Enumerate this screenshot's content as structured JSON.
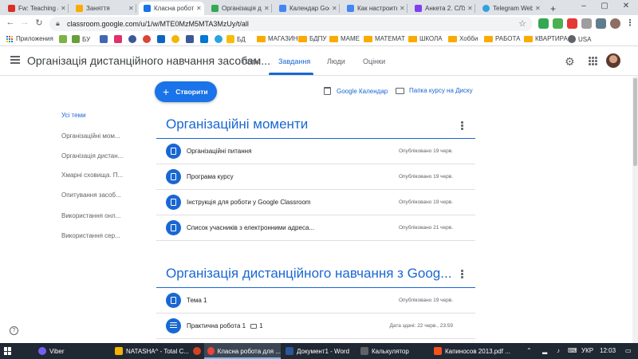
{
  "browser": {
    "tabs": [
      {
        "label": "Fw: Teaching a",
        "color": "#d93025"
      },
      {
        "label": "Заняття",
        "color": "#f9ab00"
      },
      {
        "label": "Класна робота",
        "color": "#1a73e8"
      },
      {
        "label": "Організація д",
        "color": "#34a853"
      },
      {
        "label": "Календар Goo",
        "color": "#4285f4"
      },
      {
        "label": "Как настроить",
        "color": "#4285f4"
      },
      {
        "label": "Анкета 2. СЛУ",
        "color": "#7e3ff2"
      },
      {
        "label": "Telegram Web",
        "color": "#2aa3e0"
      }
    ],
    "new_tab": "+",
    "window_controls": [
      "–",
      "▢",
      "✕"
    ],
    "url": "classroom.google.com/u/1/w/MTE0MzM5MTA3MzUy/t/all",
    "bookmarks": [
      {
        "label": "Приложения",
        "icon": "apps-icon"
      },
      {
        "label": "",
        "icon": "site-icon"
      },
      {
        "label": "БУ",
        "icon": "site-icon"
      },
      {
        "label": "БД",
        "icon": "site-icon"
      },
      {
        "label": "МАГАЗИН",
        "icon": "folder-icon"
      },
      {
        "label": "БДПУ",
        "icon": "folder-icon"
      },
      {
        "label": "МАМЕ",
        "icon": "folder-icon"
      },
      {
        "label": "МАТЕМАТ",
        "icon": "folder-icon"
      },
      {
        "label": "ШКОЛА",
        "icon": "folder-icon"
      },
      {
        "label": "Хобби",
        "icon": "folder-icon"
      },
      {
        "label": "РАБОТА",
        "icon": "folder-icon"
      },
      {
        "label": "КВАРТИРА",
        "icon": "folder-icon"
      },
      {
        "label": "USA",
        "icon": "globe-icon"
      }
    ]
  },
  "app": {
    "title": "Організація дистанційного навчання засобам...",
    "tabs": [
      "Потік",
      "Завдання",
      "Люди",
      "Оцінки"
    ],
    "active_tab": "Завдання"
  },
  "sidebar": {
    "topics": [
      "Усі теми",
      "Організаційні мом...",
      "Організація дистан...",
      "Хмарні сховища. П...",
      "Опитування засоб...",
      "Використання онл...",
      "Використання сер..."
    ]
  },
  "main": {
    "create_label": "Створити",
    "calendar_link": "Google Календар",
    "drive_link": "Папка курсу на Диску",
    "sections": [
      {
        "title": "Організаційні моменти",
        "items": [
          {
            "title": "Організаційні питання",
            "meta": "Опубліковано 19 черв.",
            "icon": "material"
          },
          {
            "title": "Програма курсу",
            "meta": "Опубліковано 19 черв.",
            "icon": "material"
          },
          {
            "title": "Інструкція для роботи у Google Classroom",
            "meta": "Опубліковано 19 черв.",
            "icon": "material"
          },
          {
            "title": "Список учасників з електронними адреса...",
            "meta": "Опубліковано 21 черв.",
            "icon": "material"
          }
        ]
      },
      {
        "title": "Організація дистанційного навчання з Goog...",
        "items": [
          {
            "title": "Тема 1",
            "meta": "Опубліковано 19 черв.",
            "icon": "material",
            "comments": ""
          },
          {
            "title": "Практична робота 1",
            "meta": "Дата здачі: 22 черв., 23:59",
            "icon": "assignment",
            "comments": "1"
          }
        ]
      }
    ]
  },
  "help": "?",
  "taskbar": {
    "items": [
      {
        "label": "Viber",
        "color": "#7360f2"
      },
      {
        "label": "NATASHA^ - Total C...",
        "color": "#f4b400"
      },
      {
        "label": "",
        "color": "#d04423"
      },
      {
        "label": "Класна робота для ...",
        "color": "#e8453c"
      },
      {
        "label": "Документ1 - Word",
        "color": "#2b579a"
      },
      {
        "label": "Калькулятор",
        "color": "#5f6368"
      },
      {
        "label": "Капиносов 2013.pdf ...",
        "color": "#f4511e"
      }
    ],
    "language": "УКР",
    "time": "12:03"
  }
}
